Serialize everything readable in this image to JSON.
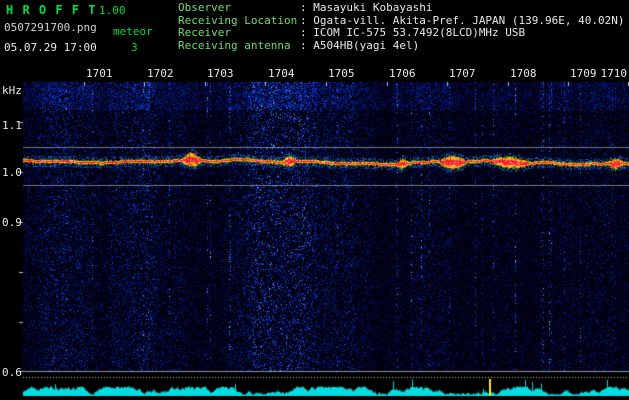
{
  "app": {
    "title": "H R O F F T",
    "version": "1.00",
    "filename": "0507291700.png",
    "mode": "meteor",
    "count": "3",
    "datetime": "05.07.29 17:00"
  },
  "header": {
    "rows": [
      {
        "label": "Observer",
        "sep": ": ",
        "value": "Masayuki Kobayashi"
      },
      {
        "label": "Receiving Location",
        "sep": ": ",
        "value": "Ogata-vill. Akita-Pref. JAPAN (139.96E, 40.02N)"
      },
      {
        "label": "Receiver",
        "sep": ": ",
        "value": "ICOM IC-575 53.7492(8LCD)MHz USB"
      },
      {
        "label": "Receiving antenna",
        "sep": ": ",
        "value": "A504HB(yagi 4el)"
      }
    ]
  },
  "time_axis": {
    "ticks": [
      "1701",
      "1702",
      "1703",
      "1704",
      "1705",
      "1706",
      "1707",
      "1708",
      "1709",
      "1710"
    ]
  },
  "freq_axis": {
    "unit": "kHz",
    "ticks": [
      "1.1",
      "1.0",
      "0.9",
      "0.6"
    ]
  },
  "colors": {
    "green": "#00dc3c",
    "white": "#e8e8e8",
    "noise_blue": "#0030c0",
    "carrier_red": "#ff2030",
    "carrier_yellow": "#ffb400",
    "fringe_green": "#46c41e",
    "grid_gray": "#d7d7d7",
    "strip_cyan": "#00dde0",
    "spike_yellow": "#ffe818"
  }
}
